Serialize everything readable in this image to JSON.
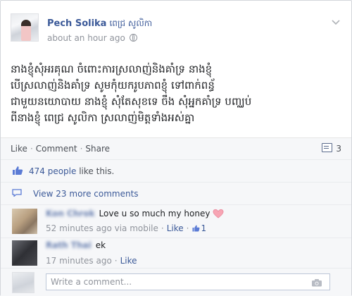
{
  "post": {
    "author": "Pech Solika",
    "author_alt": "ពេជ្រ សូលិកា",
    "time": "about an hour ago",
    "audience_icon": "globe-icon",
    "menu_icon": "chevron-down-icon",
    "body_lines": [
      "នាងខ្ញុំសុំអរគុណ ចំពោះការស្រលាញ់និងគាំទ្រ នាងខ្ញុំ",
      "បើស្រលាញ់និងគាំទ្រ សូមកុំយករូបភាពខ្ញុំ ទៅពាក់ពន្ធ័",
      "ជាមួយនយោបាយ នាងខ្ញុំ សុំតែសុខទេ ចឹង សុំអ្នកគាំទ្រ បញ្ឈប់",
      "ពីនាងខ្ញុំ ពេជ្រ សូលិកា ស្រលាញ់មិត្តទាំងអស់គ្នា"
    ]
  },
  "actions": {
    "like": "Like",
    "comment": "Comment",
    "share": "Share",
    "share_count": "3",
    "separator": "·"
  },
  "likes": {
    "people": "474 people",
    "suffix": " like this."
  },
  "more_comments": "View 23 more comments",
  "comments": [
    {
      "author": "Kon Chrok",
      "text": "Love u so much my honey",
      "time": "52 minutes ago via mobile",
      "like": "Like",
      "like_count": "1",
      "emoji": "heart-icon"
    },
    {
      "author": "Rath Thai",
      "text": "ek",
      "time": "17 minutes ago",
      "like": "Like"
    }
  ],
  "write_comment": {
    "placeholder": "Write a comment..."
  },
  "colors": {
    "link": "#3b5998",
    "muted": "#90949c",
    "panel": "#f6f7f9",
    "heart": "#f25268"
  }
}
